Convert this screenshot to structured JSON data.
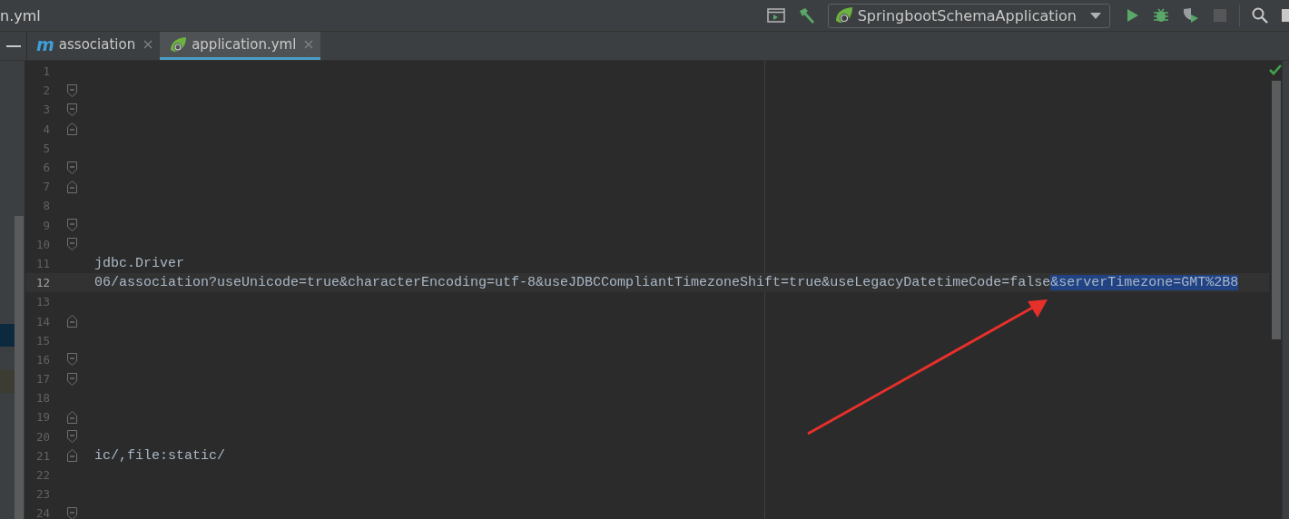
{
  "window": {
    "title": "n.yml"
  },
  "run_config": {
    "label": "SpringbootSchemaApplication"
  },
  "tabs": [
    {
      "label": "association",
      "kind": "module",
      "icon_text": "m",
      "selected": false
    },
    {
      "label": "application.yml",
      "kind": "spring",
      "selected": true
    }
  ],
  "lines": [
    {
      "number": "1",
      "kind": "plain",
      "current": false
    },
    {
      "number": "2",
      "kind": "foldstart",
      "current": false
    },
    {
      "number": "3",
      "kind": "foldstart",
      "current": false
    },
    {
      "number": "4",
      "kind": "foldend",
      "current": false
    },
    {
      "number": "5",
      "kind": "plain",
      "current": false
    },
    {
      "number": "6",
      "kind": "foldstart",
      "current": false
    },
    {
      "number": "7",
      "kind": "foldend",
      "current": false
    },
    {
      "number": "8",
      "kind": "plain",
      "current": false
    },
    {
      "number": "9",
      "kind": "foldstart",
      "current": false
    },
    {
      "number": "10",
      "kind": "foldstart",
      "current": false
    },
    {
      "number": "11",
      "kind": "plain",
      "current": false,
      "text": "jdbc.Driver"
    },
    {
      "number": "12",
      "kind": "plain",
      "current": true,
      "text": "06/association?useUnicode=true&characterEncoding=utf-8&useJDBCCompliantTimezoneShift=true&useLegacyDatetimeCode=false",
      "selected_text": "&serverTimezone=GMT%2B8"
    },
    {
      "number": "13",
      "kind": "plain",
      "current": false
    },
    {
      "number": "14",
      "kind": "foldend",
      "current": false
    },
    {
      "number": "15",
      "kind": "plain",
      "current": false
    },
    {
      "number": "16",
      "kind": "foldstart",
      "current": false
    },
    {
      "number": "17",
      "kind": "foldstart",
      "current": false
    },
    {
      "number": "18",
      "kind": "plain",
      "current": false
    },
    {
      "number": "19",
      "kind": "foldend",
      "current": false
    },
    {
      "number": "20",
      "kind": "foldstart",
      "current": false
    },
    {
      "number": "21",
      "kind": "foldend",
      "current": false,
      "text": "ic/,file:static/"
    },
    {
      "number": "22",
      "kind": "plain",
      "current": false
    },
    {
      "number": "23",
      "kind": "plain",
      "current": false
    },
    {
      "number": "24",
      "kind": "foldstart",
      "current": false
    }
  ]
}
